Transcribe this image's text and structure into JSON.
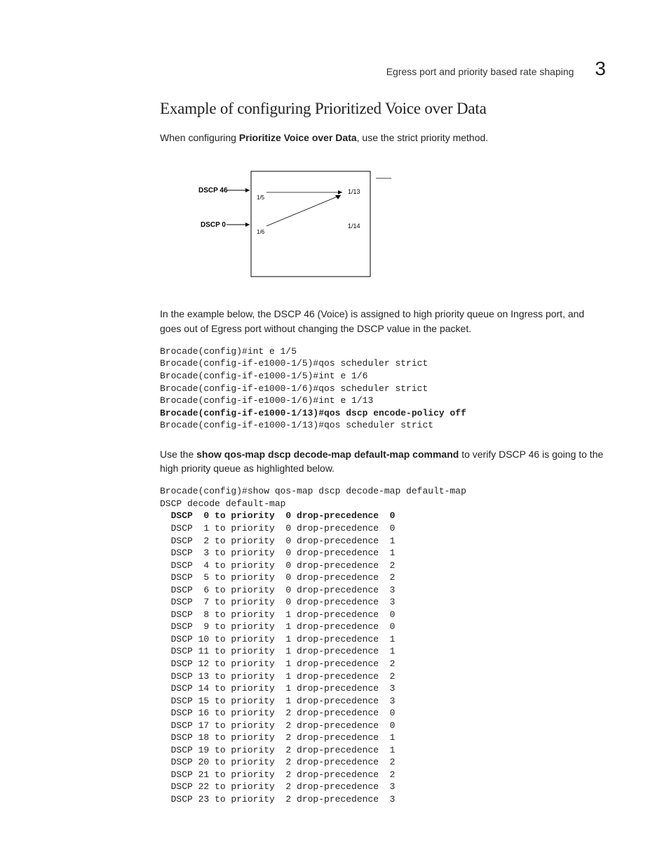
{
  "header": {
    "running_title": "Egress port and priority based rate shaping",
    "chapter_number": "3"
  },
  "section": {
    "title": "Example of configuring Prioritized Voice over Data",
    "intro_prefix": "When configuring ",
    "intro_bold": "Prioritize Voice over Data",
    "intro_suffix": ", use the strict priority method.",
    "example_para": "In the example below, the DSCP 46  (Voice) is assigned to high priority queue on Ingress port, and goes out of Egress port without changing the DSCP value in the packet.",
    "verify_prefix": "Use the ",
    "verify_bold": "show qos-map dscp decode-map default-map command",
    "verify_suffix": " to verify DSCP 46 is going to the high priority queue as highlighted below."
  },
  "diagram": {
    "dscp46": "DSCP 46",
    "dscp0": "DSCP 0",
    "p15": "1/5",
    "p16": "1/6",
    "p113": "1/13",
    "p114": "1/14"
  },
  "code1": {
    "l1": "Brocade(config)#int e 1/5",
    "l2": "Brocade(config-if-e1000-1/5)#qos scheduler strict",
    "l3": "Brocade(config-if-e1000-1/5)#int e 1/6",
    "l4": "Brocade(config-if-e1000-1/6)#qos scheduler strict",
    "l5": "Brocade(config-if-e1000-1/6)#int e 1/13",
    "l6": "Brocade(config-if-e1000-1/13)#qos dscp encode-policy off",
    "l7": "Brocade(config-if-e1000-1/13)#qos scheduler strict"
  },
  "code2": {
    "head1": "Brocade(config)#show qos-map dscp decode-map default-map",
    "head2": "DSCP decode default-map",
    "rows": [
      {
        "d": " 0",
        "p": "0",
        "dp": "0",
        "bold": true
      },
      {
        "d": " 1",
        "p": "0",
        "dp": "0",
        "bold": false
      },
      {
        "d": " 2",
        "p": "0",
        "dp": "1",
        "bold": false
      },
      {
        "d": " 3",
        "p": "0",
        "dp": "1",
        "bold": false
      },
      {
        "d": " 4",
        "p": "0",
        "dp": "2",
        "bold": false
      },
      {
        "d": " 5",
        "p": "0",
        "dp": "2",
        "bold": false
      },
      {
        "d": " 6",
        "p": "0",
        "dp": "3",
        "bold": false
      },
      {
        "d": " 7",
        "p": "0",
        "dp": "3",
        "bold": false
      },
      {
        "d": " 8",
        "p": "1",
        "dp": "0",
        "bold": false
      },
      {
        "d": " 9",
        "p": "1",
        "dp": "0",
        "bold": false
      },
      {
        "d": "10",
        "p": "1",
        "dp": "1",
        "bold": false
      },
      {
        "d": "11",
        "p": "1",
        "dp": "1",
        "bold": false
      },
      {
        "d": "12",
        "p": "1",
        "dp": "2",
        "bold": false
      },
      {
        "d": "13",
        "p": "1",
        "dp": "2",
        "bold": false
      },
      {
        "d": "14",
        "p": "1",
        "dp": "3",
        "bold": false
      },
      {
        "d": "15",
        "p": "1",
        "dp": "3",
        "bold": false
      },
      {
        "d": "16",
        "p": "2",
        "dp": "0",
        "bold": false
      },
      {
        "d": "17",
        "p": "2",
        "dp": "0",
        "bold": false
      },
      {
        "d": "18",
        "p": "2",
        "dp": "1",
        "bold": false
      },
      {
        "d": "19",
        "p": "2",
        "dp": "1",
        "bold": false
      },
      {
        "d": "20",
        "p": "2",
        "dp": "2",
        "bold": false
      },
      {
        "d": "21",
        "p": "2",
        "dp": "2",
        "bold": false
      },
      {
        "d": "22",
        "p": "2",
        "dp": "3",
        "bold": false
      },
      {
        "d": "23",
        "p": "2",
        "dp": "3",
        "bold": false
      }
    ]
  }
}
